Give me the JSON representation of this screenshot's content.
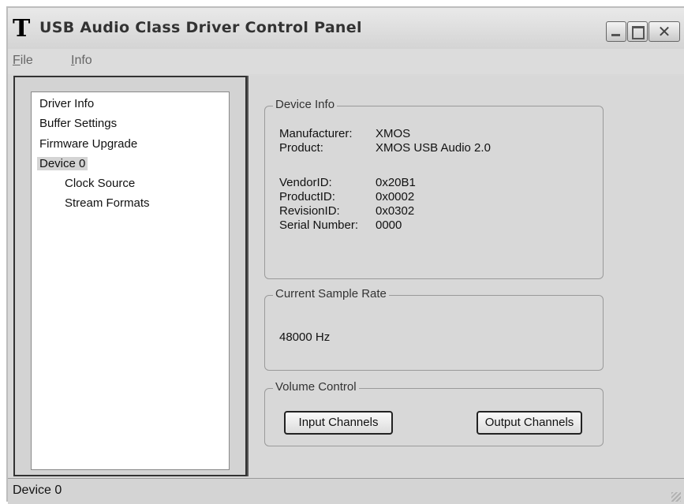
{
  "window": {
    "title": "USB Audio Class Driver Control Panel",
    "icon": "T"
  },
  "menu": {
    "file": {
      "first": "F",
      "rest": "ile"
    },
    "info": {
      "first": "I",
      "rest": "nfo"
    }
  },
  "tree": {
    "items": [
      {
        "label": "Driver Info"
      },
      {
        "label": "Buffer Settings"
      },
      {
        "label": "Firmware Upgrade"
      },
      {
        "label": "Device 0"
      },
      {
        "label": "Clock Source"
      },
      {
        "label": "Stream Formats"
      }
    ],
    "selected": "Device 0"
  },
  "device_info": {
    "title": "Device Info",
    "manufacturer": {
      "label": "Manufacturer:",
      "value": "XMOS"
    },
    "product": {
      "label": "Product:",
      "value": "XMOS USB Audio 2.0"
    },
    "vendor_id": {
      "label": "VendorID:",
      "value": "0x20B1"
    },
    "product_id": {
      "label": "ProductID:",
      "value": "0x0002"
    },
    "revision_id": {
      "label": "RevisionID:",
      "value": "0x0302"
    },
    "serial_number": {
      "label": "Serial Number:",
      "value": "0000"
    }
  },
  "sample_rate": {
    "title": "Current Sample Rate",
    "value": "48000 Hz"
  },
  "volume_control": {
    "title": "Volume Control",
    "input_button": "Input Channels",
    "output_button": "Output Channels"
  },
  "status": {
    "text": "Device 0"
  },
  "icons": {
    "app": "t-logo-icon",
    "minimize": "minimize-icon",
    "maximize": "maximize-icon",
    "close": "close-icon",
    "resize": "resize-grip-icon"
  }
}
